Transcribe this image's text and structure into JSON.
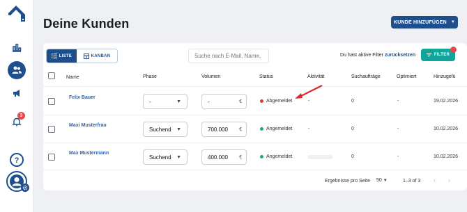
{
  "sidebar": {
    "items": [
      {
        "name": "home-logo",
        "active": false
      },
      {
        "name": "statistics",
        "active": false
      },
      {
        "name": "customers",
        "active": true
      },
      {
        "name": "announcements",
        "active": false
      },
      {
        "name": "notifications",
        "active": false,
        "badge": "3"
      },
      {
        "name": "help",
        "active": false
      },
      {
        "name": "profile",
        "active": false
      }
    ]
  },
  "header": {
    "title": "Deine Kunden",
    "add_button": "KUNDE HINZUFÜGEN"
  },
  "toolbar": {
    "view_list": "LISTE",
    "view_kanban": "KANBAN",
    "search_placeholder": "Suche nach E-Mail, Name,",
    "filter_text": "Du hast aktive Filter",
    "filter_reset": "zurücksetzen",
    "filter_button": "FILTER"
  },
  "table": {
    "headers": [
      "Name",
      "Phase",
      "Volumen",
      "Status",
      "Aktivität",
      "Suchaufträge",
      "Optimiert",
      "Hinzugefü"
    ],
    "rows": [
      {
        "name": "Felix Bauer",
        "phase": "-",
        "volume": "-",
        "currency": "€",
        "status": "Abgemeldet",
        "activity": "-",
        "searches": "0",
        "optimized": "-",
        "added": "19.02.2026"
      },
      {
        "name": "Maxi Musterfrau",
        "phase": "Suchend",
        "volume": "700.000",
        "currency": "€",
        "status": "Angemeldet",
        "activity": "-",
        "searches": "0",
        "optimized": "-",
        "added": "10.02.2026"
      },
      {
        "name": "Max Mustermann",
        "phase": "Suchend",
        "volume": "400.000",
        "currency": "€",
        "status": "Angemeldet",
        "activity": "",
        "searches": "0",
        "optimized": "-",
        "added": "10.02.2026"
      }
    ]
  },
  "pagination": {
    "rows_per_page_label": "Ergebnisse pro Seite",
    "rows_per_page": "50",
    "range": "1–3 of 3"
  },
  "colors": {
    "primary": "#1f4e8c",
    "teal": "#12a399",
    "status_red": "#d93a3a",
    "status_green": "#1aa88f"
  }
}
